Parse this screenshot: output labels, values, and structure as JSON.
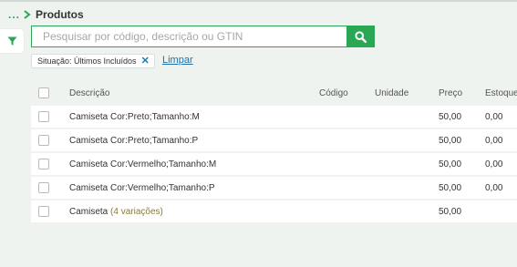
{
  "breadcrumb": {
    "ellipsis": "...",
    "title": "Produtos"
  },
  "search": {
    "placeholder": "Pesquisar por código, descrição ou GTIN",
    "value": ""
  },
  "filters": {
    "chip_label": "Situação: Últimos Incluídos",
    "chip_close": "✕",
    "clear_label": "Limpar"
  },
  "table": {
    "columns": {
      "descricao": "Descrição",
      "codigo": "Código",
      "unidade": "Unidade",
      "preco": "Preço",
      "estoque": "Estoque"
    },
    "rows": [
      {
        "descricao": "Camiseta Cor:Preto;Tamanho:M",
        "codigo": "",
        "unidade": "",
        "preco": "50,00",
        "estoque": "0,00"
      },
      {
        "descricao": "Camiseta Cor:Preto;Tamanho:P",
        "codigo": "",
        "unidade": "",
        "preco": "50,00",
        "estoque": "0,00"
      },
      {
        "descricao": "Camiseta Cor:Vermelho;Tamanho:M",
        "codigo": "",
        "unidade": "",
        "preco": "50,00",
        "estoque": "0,00"
      },
      {
        "descricao": "Camiseta Cor:Vermelho;Tamanho:P",
        "codigo": "",
        "unidade": "",
        "preco": "50,00",
        "estoque": "0,00"
      },
      {
        "descricao": "Camiseta",
        "variacoes": "(4 variações)",
        "codigo": "",
        "unidade": "",
        "preco": "50,00",
        "estoque": ""
      }
    ]
  },
  "colors": {
    "accent": "#2aa654",
    "link": "#1f6fa8",
    "background": "#eef3f0"
  }
}
